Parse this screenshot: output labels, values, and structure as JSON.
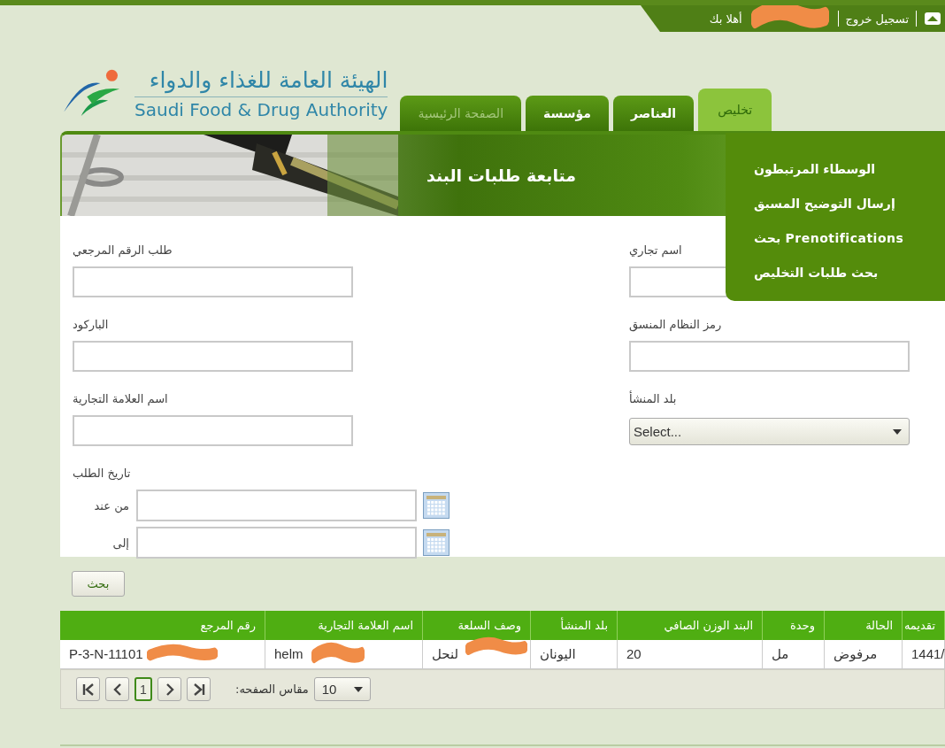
{
  "top_bar": {
    "logout": "تسجيل خروج",
    "greeting": "أهلا بك"
  },
  "logo": {
    "arabic": "الهيئة العامة للغذاء والدواء",
    "english": "Saudi Food & Drug Authority"
  },
  "tabs": [
    {
      "label": "تخليص",
      "selected": true,
      "disabled": false
    },
    {
      "label": "العناصر",
      "selected": false,
      "disabled": false
    },
    {
      "label": "مؤسسة",
      "selected": false,
      "disabled": false
    },
    {
      "label": "الصفحة الرئيسية",
      "selected": false,
      "disabled": true
    }
  ],
  "menu": {
    "items": [
      "الوسطاء المرتبطون",
      "إرسال التوضيح المسبق",
      "Prenotifications بحث",
      "بحث طلبات التخليص"
    ]
  },
  "banner": {
    "title": "متابعة طلبات البند"
  },
  "form": {
    "left_fields": [
      {
        "label": "طلب الرقم المرجعي",
        "kind": "text"
      },
      {
        "label": "الباركود",
        "kind": "text"
      },
      {
        "label": "اسم العلامة التجارية",
        "kind": "text"
      }
    ],
    "right_fields": [
      {
        "label": "اسم تجاري",
        "kind": "text"
      },
      {
        "label": "رمز النظام المنسق",
        "kind": "text"
      },
      {
        "label": "بلد المنشأ",
        "kind": "select",
        "value": "Select..."
      }
    ],
    "date_range": {
      "label": "تاريخ الطلب",
      "rows": [
        "من عند",
        "إلى"
      ]
    }
  },
  "search_button": "بحث",
  "table": {
    "columns": [
      "تقديمه",
      "الحالة",
      "وحدة",
      "البند الوزن الصافي",
      "بلد المنشأ",
      "وصف السلعة",
      "اسم العلامة التجارية",
      "رقم المرجع"
    ],
    "rows": [
      {
        "cells": [
          "1441/",
          "مرفوض",
          "مل",
          "20",
          "اليونان",
          "لنحل",
          "helm",
          "P-3-N-11101"
        ]
      }
    ]
  },
  "pager": {
    "pages": [
      {
        "label": "1",
        "selected": true
      }
    ],
    "page_size_label": "مقاس الصفحه:",
    "page_size": "10"
  }
}
